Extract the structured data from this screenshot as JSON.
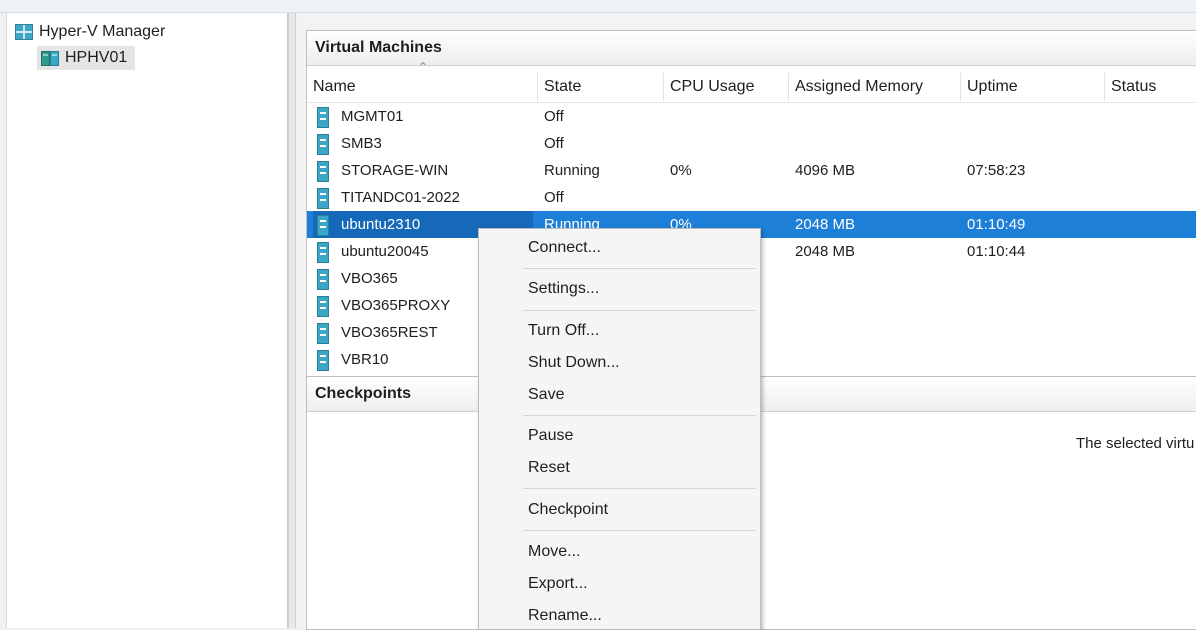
{
  "tree": {
    "root_label": "Hyper-V Manager",
    "server_label": "HPHV01"
  },
  "vm_panel": {
    "title": "Virtual Machines",
    "columns": [
      "Name",
      "State",
      "CPU Usage",
      "Assigned Memory",
      "Uptime",
      "Status"
    ],
    "rows": [
      {
        "name": "MGMT01",
        "state": "Off",
        "cpu": "",
        "memory": "",
        "uptime": "",
        "status": ""
      },
      {
        "name": "SMB3",
        "state": "Off",
        "cpu": "",
        "memory": "",
        "uptime": "",
        "status": ""
      },
      {
        "name": "STORAGE-WIN",
        "state": "Running",
        "cpu": "0%",
        "memory": "4096 MB",
        "uptime": "07:58:23",
        "status": ""
      },
      {
        "name": "TITANDC01-2022",
        "state": "Off",
        "cpu": "",
        "memory": "",
        "uptime": "",
        "status": ""
      },
      {
        "name": "ubuntu2310",
        "state": "Running",
        "cpu": "0%",
        "memory": "2048 MB",
        "uptime": "01:10:49",
        "status": "",
        "selected": true
      },
      {
        "name": "ubuntu20045",
        "state": "",
        "cpu": "",
        "memory": "2048 MB",
        "uptime": "01:10:44",
        "status": ""
      },
      {
        "name": "VBO365",
        "state": "",
        "cpu": "",
        "memory": "",
        "uptime": "",
        "status": ""
      },
      {
        "name": "VBO365PROXY",
        "state": "",
        "cpu": "",
        "memory": "",
        "uptime": "",
        "status": ""
      },
      {
        "name": "VBO365REST",
        "state": "",
        "cpu": "",
        "memory": "",
        "uptime": "",
        "status": ""
      },
      {
        "name": "VBR10",
        "state": "",
        "cpu": "",
        "memory": "",
        "uptime": "",
        "status": ""
      }
    ]
  },
  "checkpoints_panel": {
    "title": "Checkpoints",
    "message": "The selected virtu"
  },
  "context_menu": {
    "items": [
      "Connect...",
      "Settings...",
      "Turn Off...",
      "Shut Down...",
      "Save",
      "Pause",
      "Reset",
      "Checkpoint",
      "Move...",
      "Export...",
      "Rename..."
    ]
  },
  "colors": {
    "selection": "#1d7fd7",
    "vm_icon": "#3aa7c6"
  }
}
